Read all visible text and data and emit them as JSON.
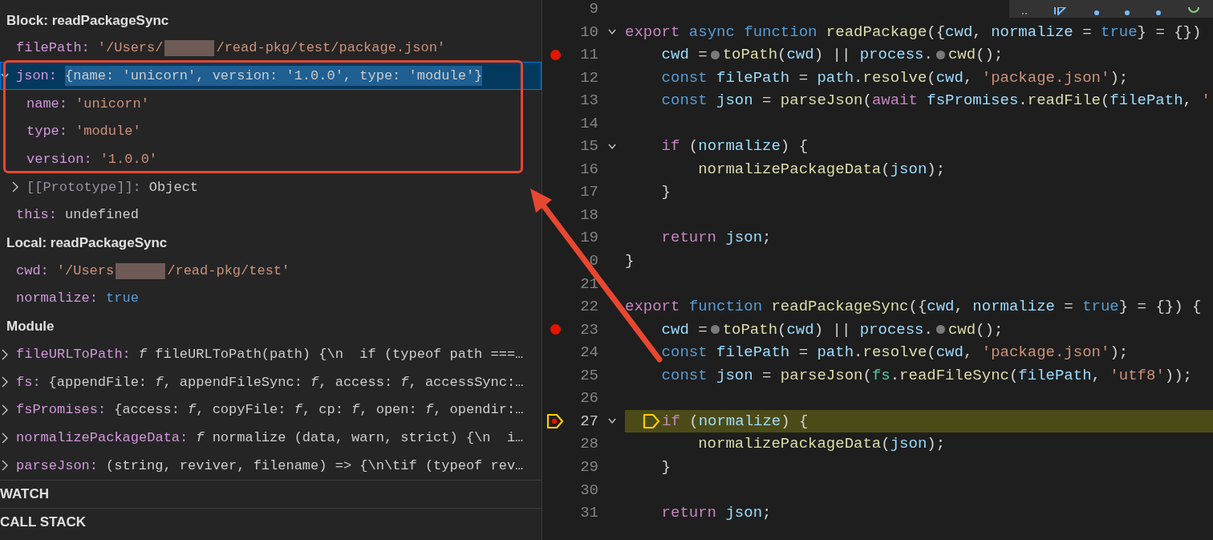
{
  "variables_panel": {
    "scopes": [
      {
        "title": "Block: readPackageSync",
        "items": [
          {
            "name": "filePath:",
            "kind": "string",
            "value_segments": [
              "'/Users/",
              "/read-pkg/test/package.json'"
            ]
          },
          {
            "name": "json:",
            "kind": "object",
            "value": "{name: 'unicorn', version: '1.0.0', type: 'module'}",
            "expanded": true,
            "selected": true,
            "children": [
              {
                "name": "name:",
                "kind": "string",
                "value": "'unicorn'"
              },
              {
                "name": "type:",
                "kind": "string",
                "value": "'module'"
              },
              {
                "name": "version:",
                "kind": "string",
                "value": "'1.0.0'"
              },
              {
                "name": "[[Prototype]]:",
                "kind": "internal",
                "value": "Object",
                "expanded": false,
                "selected": false
              }
            ]
          },
          {
            "name": "this:",
            "kind": "plain",
            "value": "undefined"
          }
        ]
      },
      {
        "title": "Local: readPackageSync",
        "items": [
          {
            "name": "cwd:",
            "kind": "string",
            "value_segments": [
              "'/Users",
              "/read-pkg/test'"
            ]
          },
          {
            "name": "normalize:",
            "kind": "boolean",
            "value": "true"
          }
        ]
      },
      {
        "title": "Module",
        "items": [
          {
            "name": "fileURLToPath:",
            "kind": "plain",
            "value": "*f* fileURLToPath(path) {\\n  if (typeof path ===…",
            "expanded": false,
            "selected": false
          },
          {
            "name": "fs:",
            "kind": "plain",
            "value": "{appendFile: *f*, appendFileSync: *f*, access: *f*, accessSync:…",
            "expanded": false,
            "selected": false
          },
          {
            "name": "fsPromises:",
            "kind": "plain",
            "value": "{access: *f*, copyFile: *f*, cp: *f*, open: *f*, opendir:…",
            "expanded": false,
            "selected": false
          },
          {
            "name": "normalizePackageData:",
            "kind": "plain",
            "value": "*f* normalize (data, warn, strict) {\\n  i…",
            "expanded": false,
            "selected": false
          },
          {
            "name": "parseJson:",
            "kind": "plain",
            "value": "(string, reviver, filename) => {\\n\\tif (typeof rev…",
            "expanded": false,
            "selected": false
          }
        ]
      }
    ],
    "sections": [
      {
        "title": "WATCH"
      },
      {
        "title": "CALL STACK"
      }
    ]
  },
  "editor": {
    "lines": [
      {
        "number": "9"
      },
      {
        "number": "10",
        "fold": true,
        "tokens": [
          {
            "kind": "kw",
            "text": "export"
          },
          {
            "kind": "st",
            "text": " async"
          },
          {
            "kind": "st",
            "text": " function"
          },
          {
            "kind": "fn",
            "text": " readPackage"
          },
          {
            "kind": "p",
            "text": "({"
          },
          {
            "kind": "v",
            "text": "cwd"
          },
          {
            "kind": "p",
            "text": ","
          },
          {
            "kind": "v",
            "text": " normalize"
          },
          {
            "kind": "p",
            "text": " ="
          },
          {
            "kind": "st",
            "text": " true"
          },
          {
            "kind": "p",
            "text": "} = {})"
          }
        ]
      },
      {
        "number": "11",
        "breakpoint": true,
        "tokens": [
          {
            "kind": "v",
            "text": "    cwd"
          },
          {
            "kind": "p",
            "text": " ="
          },
          {
            "kind": "dot"
          },
          {
            "kind": "fn",
            "text": "toPath"
          },
          {
            "kind": "p",
            "text": "("
          },
          {
            "kind": "v",
            "text": "cwd"
          },
          {
            "kind": "p",
            "text": ") ||"
          },
          {
            "kind": "v",
            "text": " process"
          },
          {
            "kind": "p",
            "text": "."
          },
          {
            "kind": "dot"
          },
          {
            "kind": "fn",
            "text": "cwd"
          },
          {
            "kind": "p",
            "text": "();"
          }
        ]
      },
      {
        "number": "12",
        "tokens": [
          {
            "kind": "st",
            "text": "    const"
          },
          {
            "kind": "v",
            "text": " filePath"
          },
          {
            "kind": "p",
            "text": " ="
          },
          {
            "kind": "v",
            "text": " path"
          },
          {
            "kind": "p",
            "text": "."
          },
          {
            "kind": "fn",
            "text": "resolve"
          },
          {
            "kind": "p",
            "text": "("
          },
          {
            "kind": "v",
            "text": "cwd"
          },
          {
            "kind": "p",
            "text": ","
          },
          {
            "kind": "s",
            "text": " 'package.json'"
          },
          {
            "kind": "p",
            "text": ");"
          }
        ]
      },
      {
        "number": "13",
        "tokens": [
          {
            "kind": "st",
            "text": "    const"
          },
          {
            "kind": "v",
            "text": " json"
          },
          {
            "kind": "p",
            "text": " ="
          },
          {
            "kind": "fn",
            "text": " parseJson"
          },
          {
            "kind": "p",
            "text": "("
          },
          {
            "kind": "kw",
            "text": "await"
          },
          {
            "kind": "v",
            "text": " fsPromises"
          },
          {
            "kind": "p",
            "text": "."
          },
          {
            "kind": "fn",
            "text": "readFile"
          },
          {
            "kind": "p",
            "text": "("
          },
          {
            "kind": "v",
            "text": "filePath"
          },
          {
            "kind": "p",
            "text": ","
          },
          {
            "kind": "s",
            "text": " '"
          }
        ]
      },
      {
        "number": "14"
      },
      {
        "number": "15",
        "fold": true,
        "tokens": [
          {
            "kind": "kw",
            "text": "    if"
          },
          {
            "kind": "p",
            "text": " ("
          },
          {
            "kind": "v",
            "text": "normalize"
          },
          {
            "kind": "p",
            "text": ") {"
          }
        ]
      },
      {
        "number": "16",
        "tokens": [
          {
            "kind": "fn",
            "text": "        normalizePackageData"
          },
          {
            "kind": "p",
            "text": "("
          },
          {
            "kind": "v",
            "text": "json"
          },
          {
            "kind": "p",
            "text": ");"
          }
        ]
      },
      {
        "number": "17",
        "tokens": [
          {
            "kind": "p",
            "text": "    }"
          }
        ]
      },
      {
        "number": "18"
      },
      {
        "number": "19",
        "tokens": [
          {
            "kind": "kw",
            "text": "    return"
          },
          {
            "kind": "v",
            "text": " json"
          },
          {
            "kind": "p",
            "text": ";"
          }
        ]
      },
      {
        "number": "0",
        "tokens": [
          {
            "kind": "p",
            "text": "}"
          }
        ]
      },
      {
        "number": "21"
      },
      {
        "number": "22",
        "tokens": [
          {
            "kind": "kw",
            "text": "export"
          },
          {
            "kind": "st",
            "text": " function"
          },
          {
            "kind": "fn",
            "text": " readPackageSync"
          },
          {
            "kind": "p",
            "text": "({"
          },
          {
            "kind": "v",
            "text": "cwd"
          },
          {
            "kind": "p",
            "text": ","
          },
          {
            "kind": "v",
            "text": " normalize"
          },
          {
            "kind": "p",
            "text": " ="
          },
          {
            "kind": "st",
            "text": " true"
          },
          {
            "kind": "p",
            "text": "} = {}) {"
          }
        ]
      },
      {
        "number": "23",
        "breakpoint": true,
        "tokens": [
          {
            "kind": "v",
            "text": "    cwd"
          },
          {
            "kind": "p",
            "text": " ="
          },
          {
            "kind": "dot"
          },
          {
            "kind": "fn",
            "text": "toPath"
          },
          {
            "kind": "p",
            "text": "("
          },
          {
            "kind": "v",
            "text": "cwd"
          },
          {
            "kind": "p",
            "text": ") ||"
          },
          {
            "kind": "v",
            "text": " process"
          },
          {
            "kind": "p",
            "text": "."
          },
          {
            "kind": "dot"
          },
          {
            "kind": "fn",
            "text": "cwd"
          },
          {
            "kind": "p",
            "text": "();"
          }
        ]
      },
      {
        "number": "24",
        "tokens": [
          {
            "kind": "st",
            "text": "    const"
          },
          {
            "kind": "v",
            "text": " filePath"
          },
          {
            "kind": "p",
            "text": " ="
          },
          {
            "kind": "v",
            "text": " path"
          },
          {
            "kind": "p",
            "text": "."
          },
          {
            "kind": "fn",
            "text": "resolve"
          },
          {
            "kind": "p",
            "text": "("
          },
          {
            "kind": "v",
            "text": "cwd"
          },
          {
            "kind": "p",
            "text": ","
          },
          {
            "kind": "s",
            "text": " 'package.json'"
          },
          {
            "kind": "p",
            "text": ");"
          }
        ]
      },
      {
        "number": "25",
        "tokens": [
          {
            "kind": "st",
            "text": "    const"
          },
          {
            "kind": "v",
            "text": " json"
          },
          {
            "kind": "p",
            "text": " ="
          },
          {
            "kind": "fn",
            "text": " parseJson"
          },
          {
            "kind": "p",
            "text": "("
          },
          {
            "kind": "t",
            "text": "fs"
          },
          {
            "kind": "p",
            "text": "."
          },
          {
            "kind": "fn",
            "text": "readFileSync"
          },
          {
            "kind": "p",
            "text": "("
          },
          {
            "kind": "v",
            "text": "filePath"
          },
          {
            "kind": "p",
            "text": ","
          },
          {
            "kind": "s",
            "text": " 'utf8'"
          },
          {
            "kind": "p",
            "text": "));"
          }
        ]
      },
      {
        "number": "26"
      },
      {
        "number": "27",
        "fold": true,
        "breakpoint": true,
        "current": true,
        "tokens": [
          {
            "kind": "stop"
          },
          {
            "kind": "kw",
            "text": "if"
          },
          {
            "kind": "p",
            "text": " ("
          },
          {
            "kind": "v",
            "text": "normalize"
          },
          {
            "kind": "p",
            "text": ") {"
          }
        ]
      },
      {
        "number": "28",
        "tokens": [
          {
            "kind": "fn",
            "text": "        normalizePackageData"
          },
          {
            "kind": "p",
            "text": "("
          },
          {
            "kind": "v",
            "text": "json"
          },
          {
            "kind": "p",
            "text": ");"
          }
        ]
      },
      {
        "number": "29",
        "tokens": [
          {
            "kind": "p",
            "text": "    }"
          }
        ]
      },
      {
        "number": "30"
      },
      {
        "number": "31",
        "tokens": [
          {
            "kind": "kw",
            "text": "    return"
          },
          {
            "kind": "v",
            "text": " json"
          },
          {
            "kind": "p",
            "text": ";"
          }
        ]
      }
    ]
  }
}
